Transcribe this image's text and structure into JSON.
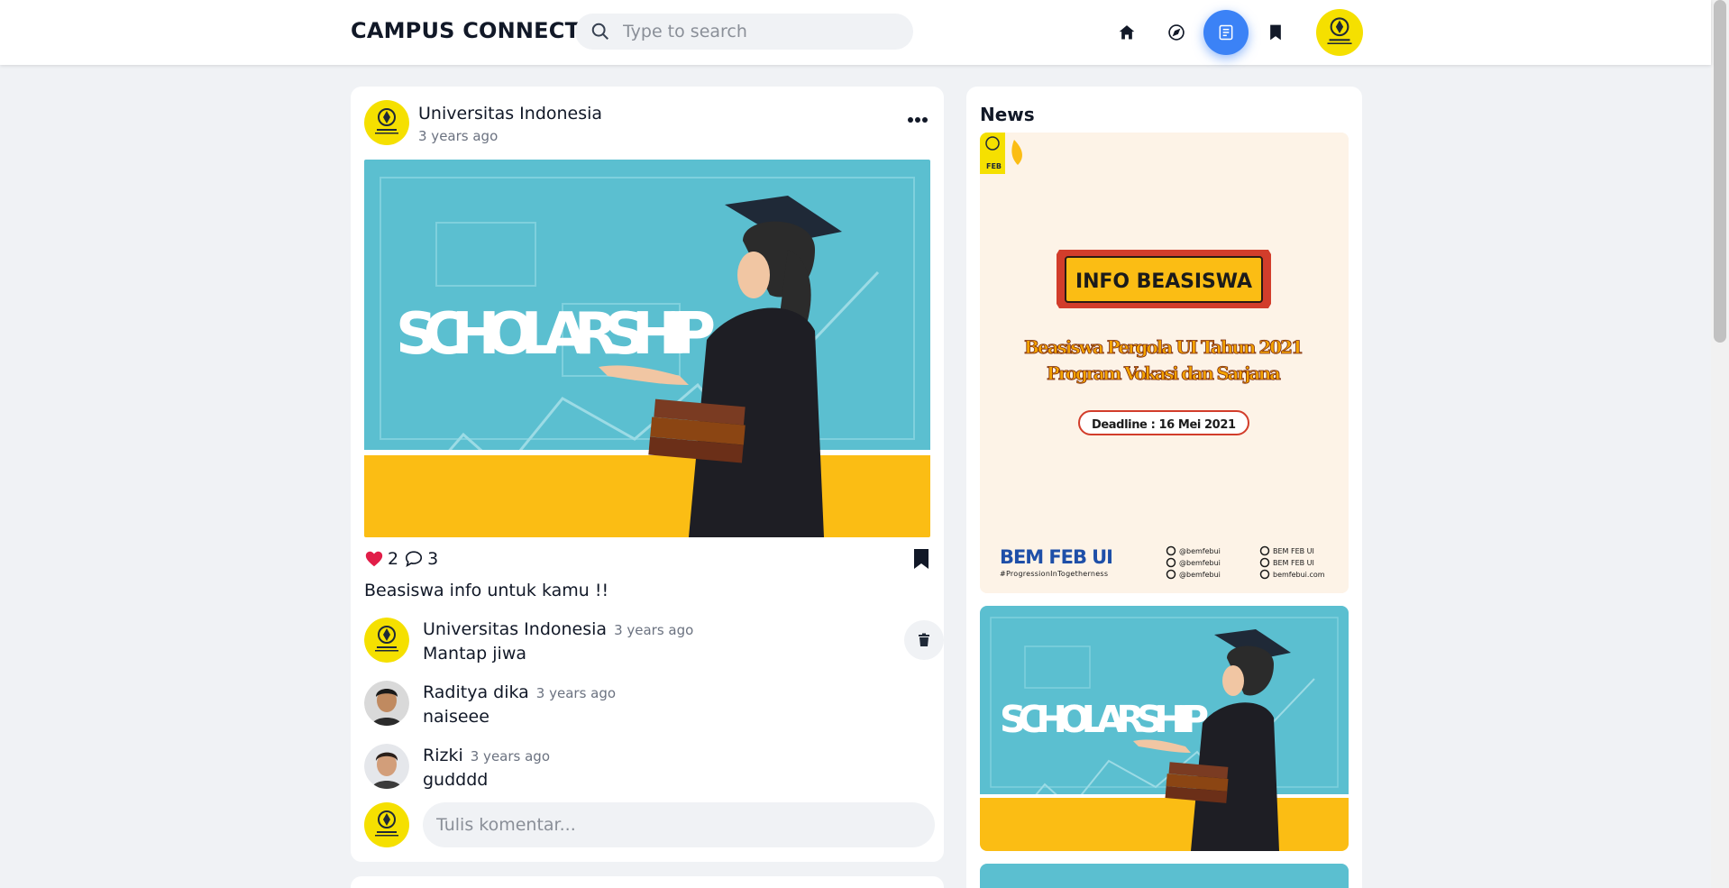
{
  "navbar": {
    "brand": "CAMPUS CONNECT",
    "search_placeholder": "Type to search",
    "icons": [
      "home-icon",
      "compass-icon",
      "news-icon",
      "bookmark-icon"
    ],
    "active_icon": "news-icon",
    "accent_color": "#3b82f6"
  },
  "post": {
    "author": "Universitas Indonesia",
    "time": "3 years ago",
    "image_text": "SCHOLARSHIP",
    "likes": "2",
    "comments_count": "3",
    "caption": "Beasiswa info untuk kamu !!",
    "comments": [
      {
        "name": "Universitas Indonesia",
        "time": "3 years ago",
        "text": "Mantap jiwa",
        "deletable": true
      },
      {
        "name": "Raditya dika",
        "time": "3 years ago",
        "text": "naiseee",
        "deletable": false
      },
      {
        "name": "Rizki",
        "time": "3 years ago",
        "text": "gudddd",
        "deletable": false
      }
    ],
    "comment_placeholder": "Tulis komentar..."
  },
  "news": {
    "title": "News",
    "poster": {
      "badge": "FEB",
      "heading": "INFO BEASISWA",
      "line1": "Beasiswa Pergola UI Tahun 2021",
      "line2": "Program Vokasi dan Sarjana",
      "deadline": "Deadline : 16 Mei 2021",
      "org": "BEM FEB UI",
      "tagline": "#ProgressionInTogetherness",
      "socials_left": [
        "@bemfebui",
        "@bemfebui",
        "@bemfebui"
      ],
      "socials_right": [
        "BEM FEB UI",
        "BEM FEB UI",
        "bemfebui.com"
      ]
    },
    "second_image_text": "SCHOLARSHIP"
  },
  "colors": {
    "teal": "#5bbfd0",
    "yellow": "#fbbd14",
    "heart": "#e11d48",
    "ui_yellow": "#f5e000"
  }
}
